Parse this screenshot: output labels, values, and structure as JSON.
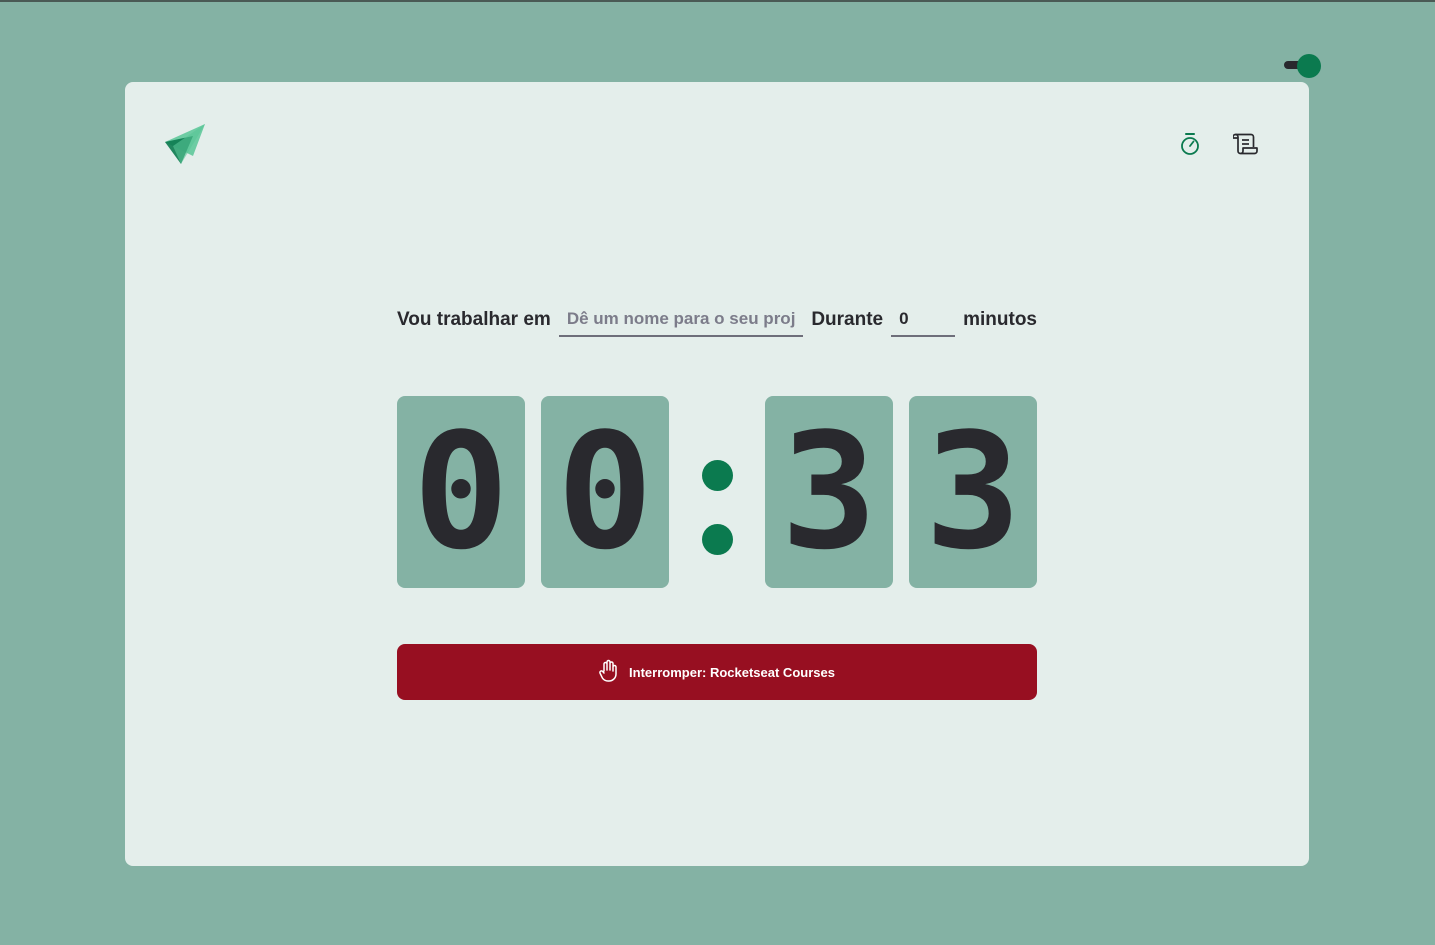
{
  "header": {
    "nav": [
      {
        "icon": "timer-icon",
        "active": true
      },
      {
        "icon": "scroll-icon",
        "active": false
      }
    ]
  },
  "form": {
    "task_label": "Vou trabalhar em",
    "task_placeholder": "Dê um nome para o seu projeto",
    "task_value": "",
    "duration_label": "Durante",
    "minutes_value": "0",
    "minutes_suffix": "minutos"
  },
  "countdown": {
    "minutes_tens": "0",
    "minutes_ones": "0",
    "seconds_tens": "3",
    "seconds_ones": "3"
  },
  "stop_button": {
    "icon": "hand-palm-icon",
    "label": "Interromper: Rocketseat Courses"
  },
  "theme_toggle": {
    "state": "on"
  },
  "colors": {
    "background": "#84b2a4",
    "card": "#e4eeeb",
    "accent": "#0b7a4f",
    "logo": "#58c596",
    "text": "#29292e",
    "danger": "#970f21"
  }
}
